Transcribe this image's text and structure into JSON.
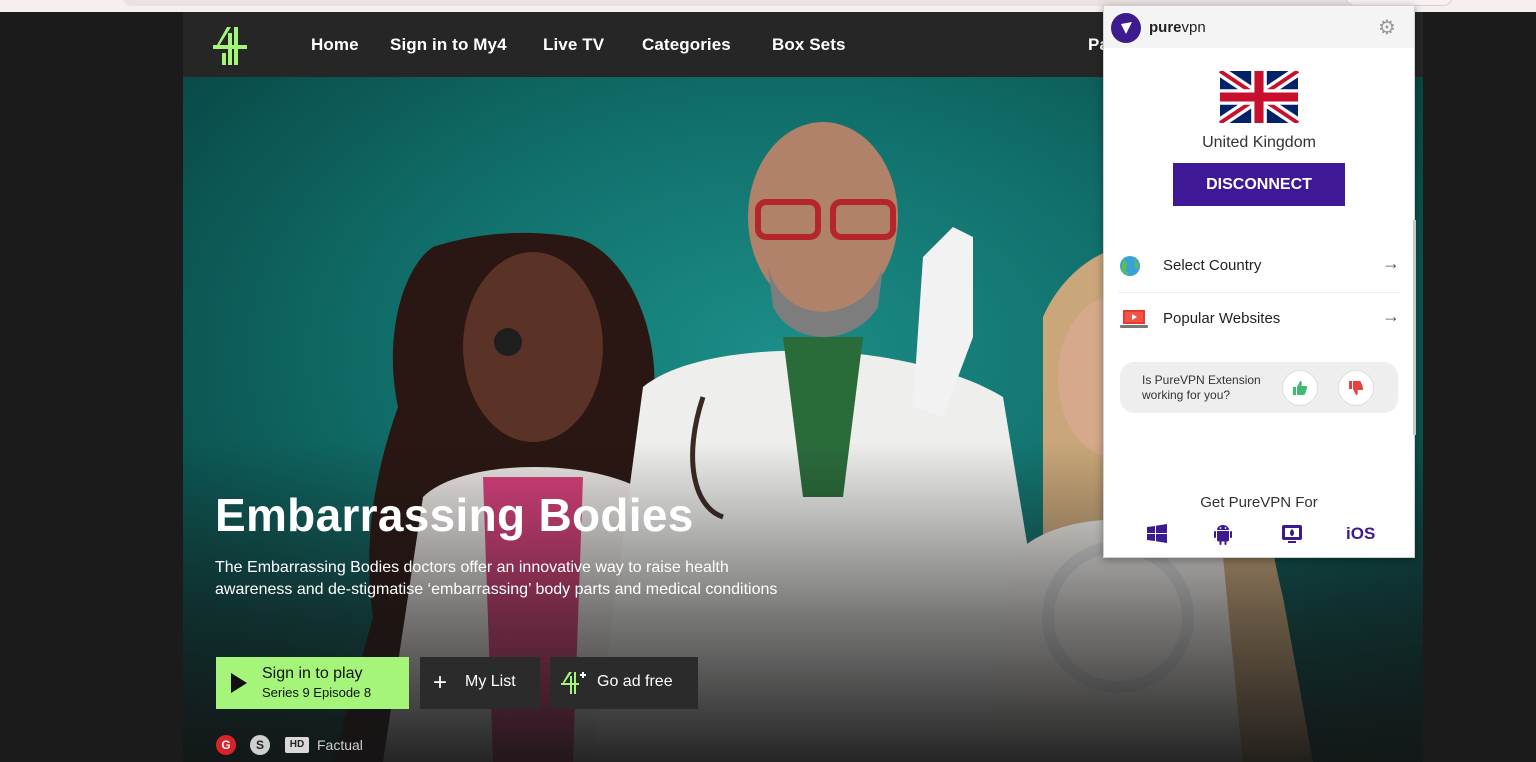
{
  "nav": {
    "items": [
      "Home",
      "Sign in to My4",
      "Live TV",
      "Categories",
      "Box Sets"
    ],
    "partial_item": "Pa"
  },
  "show": {
    "title": "Embarrassing Bodies",
    "description": "The Embarrassing Bodies doctors offer an innovative way to raise health awareness and de-stigmatise ‘embarrassing’ body parts and medical conditions",
    "play_label": "Sign in to play",
    "episode_label": "Series 9 Episode 8",
    "my_list_label": "My List",
    "ad_free_label": "Go ad free",
    "rating_g": "G",
    "rating_s": "S",
    "hd": "HD",
    "genre": "Factual"
  },
  "vpn": {
    "brand_bold": "pure",
    "brand_light": "vpn",
    "country": "United Kingdom",
    "disconnect_label": "DISCONNECT",
    "select_country": "Select Country",
    "popular_websites": "Popular Websites",
    "feedback_question": "Is PureVPN Extension working for you?",
    "get_for": "Get PureVPN For",
    "ios_label": "iOS"
  },
  "colors": {
    "channel_green": "#a4f57a",
    "vpn_purple": "#3f1898",
    "hero_teal": "#117a75"
  }
}
